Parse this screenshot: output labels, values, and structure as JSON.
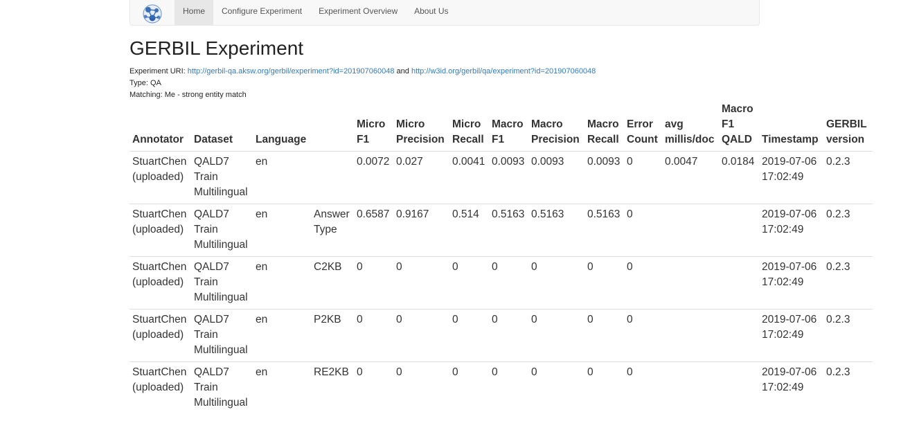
{
  "nav": {
    "logo_icon": "gerbil-logo-icon",
    "items": [
      {
        "label": "Home",
        "active": true
      },
      {
        "label": "Configure Experiment",
        "active": false
      },
      {
        "label": "Experiment Overview",
        "active": false
      },
      {
        "label": "About Us",
        "active": false
      }
    ]
  },
  "page": {
    "title": "GERBIL Experiment",
    "uri_label": "Experiment URI: ",
    "uri1": "http://gerbil-qa.aksw.org/gerbil/experiment?id=201907060048",
    "uri_join": " and ",
    "uri2": "http://w3id.org/gerbil/qa/experiment?id=201907060048",
    "type_line": "Type: QA",
    "matching_line": "Matching: Me - strong entity match"
  },
  "table": {
    "headers": [
      "Annotator",
      "Dataset",
      "Language",
      "",
      "Micro F1",
      "Micro Precision",
      "Micro Recall",
      "Macro F1",
      "Macro Precision",
      "Macro Recall",
      "Error Count",
      "avg millis/doc",
      "Macro F1 QALD",
      "Timestamp",
      "GERBIL version"
    ],
    "rows": [
      [
        "StuartChen (uploaded)",
        "QALD7 Train Multilingual",
        "en",
        "",
        "0.0072",
        "0.027",
        "0.0041",
        "0.0093",
        "0.0093",
        "0.0093",
        "0",
        "0.0047",
        "0.0184",
        "2019-07-06 17:02:49",
        "0.2.3"
      ],
      [
        "StuartChen (uploaded)",
        "QALD7 Train Multilingual",
        "en",
        "Answer Type",
        "0.6587",
        "0.9167",
        "0.514",
        "0.5163",
        "0.5163",
        "0.5163",
        "0",
        "",
        "",
        "2019-07-06 17:02:49",
        "0.2.3"
      ],
      [
        "StuartChen (uploaded)",
        "QALD7 Train Multilingual",
        "en",
        "C2KB",
        "0",
        "0",
        "0",
        "0",
        "0",
        "0",
        "0",
        "",
        "",
        "2019-07-06 17:02:49",
        "0.2.3"
      ],
      [
        "StuartChen (uploaded)",
        "QALD7 Train Multilingual",
        "en",
        "P2KB",
        "0",
        "0",
        "0",
        "0",
        "0",
        "0",
        "0",
        "",
        "",
        "2019-07-06 17:02:49",
        "0.2.3"
      ],
      [
        "StuartChen (uploaded)",
        "QALD7 Train Multilingual",
        "en",
        "RE2KB",
        "0",
        "0",
        "0",
        "0",
        "0",
        "0",
        "0",
        "",
        "",
        "2019-07-06 17:02:49",
        "0.2.3"
      ]
    ]
  }
}
